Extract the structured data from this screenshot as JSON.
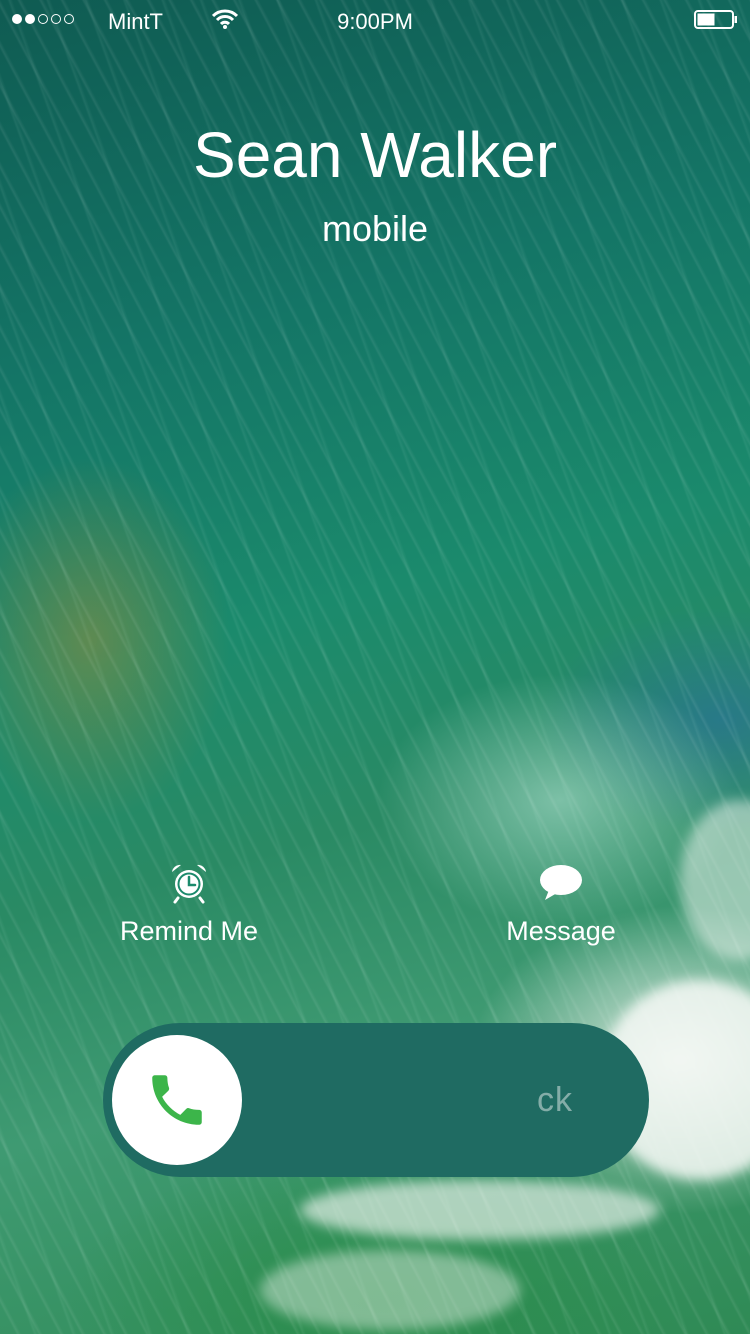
{
  "status_bar": {
    "signal_filled": 2,
    "signal_total": 5,
    "carrier": "MintT",
    "time": "9:00PM",
    "battery_level": 0.5
  },
  "call": {
    "caller_name": "Sean Walker",
    "caller_type": "mobile"
  },
  "actions": {
    "remind_label": "Remind Me",
    "remind_icon": "alarm-clock-icon",
    "message_label": "Message",
    "message_icon": "speech-bubble-icon"
  },
  "slider": {
    "label": "ck",
    "knob_icon": "phone-icon",
    "knob_icon_color": "#3cb54a",
    "track_color": "#1f6b62"
  }
}
